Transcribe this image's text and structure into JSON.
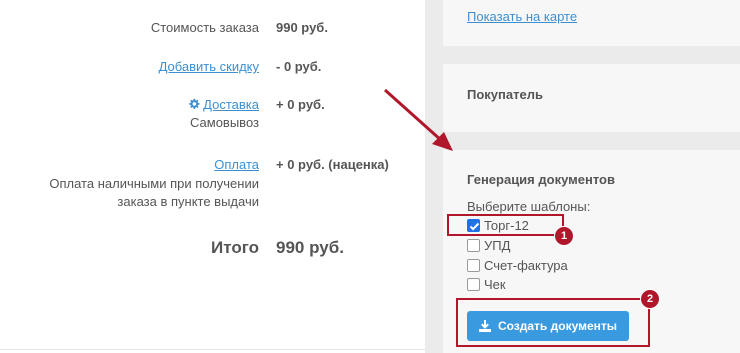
{
  "order": {
    "cost_label": "Стоимость заказа",
    "cost_value": "990 руб.",
    "discount_link": "Добавить скидку",
    "discount_value": "- 0 руб.",
    "delivery_link": "Доставка",
    "delivery_value": "+ 0 руб.",
    "delivery_method": "Самовывоз",
    "payment_link": "Оплата",
    "payment_value": "+ 0 руб. (наценка)",
    "payment_desc_1": "Оплата наличными при получении",
    "payment_desc_2": "заказа в пункте выдачи",
    "total_label": "Итого",
    "total_value": "990 руб."
  },
  "sidebar": {
    "map_link": "Показать на карте",
    "buyer_title": "Покупатель",
    "docs_title": "Генерация документов",
    "choose_label": "Выберите шаблоны:",
    "templates": [
      {
        "label": "Торг-12",
        "checked": true
      },
      {
        "label": "УПД",
        "checked": false
      },
      {
        "label": "Счет-фактура",
        "checked": false
      },
      {
        "label": "Чек",
        "checked": false
      }
    ],
    "create_button": "Создать документы"
  },
  "annotations": {
    "badge_1": "1",
    "badge_2": "2",
    "accent_color": "#b0172a"
  }
}
